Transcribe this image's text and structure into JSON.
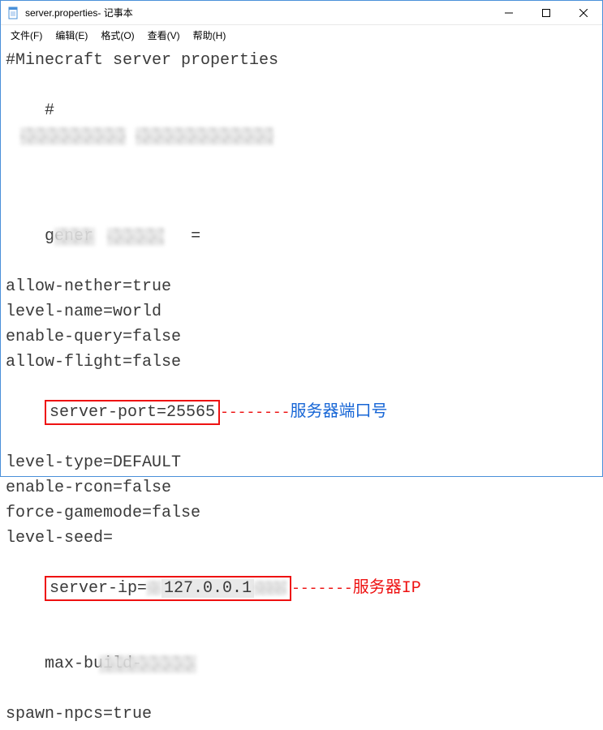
{
  "window": {
    "title": "server.properties- 记事本"
  },
  "menu": {
    "file": "文件(F)",
    "edit": "编辑(E)",
    "format": "格式(O)",
    "view": "查看(V)",
    "help": "帮助(H)"
  },
  "content": {
    "l0": "#Minecraft server properties",
    "l1a": "#",
    "l2a": "gener",
    "l2b": "=",
    "l3": "allow-nether=true",
    "l4": "level-name=world",
    "l5": "enable-query=false",
    "l6": "allow-flight=false",
    "l7": "server-port=25565",
    "l8": "level-type=DEFAULT",
    "l9": "enable-rcon=false",
    "l10": "force-gamemode=false",
    "l11": "level-seed=",
    "l12a": "server-ip=",
    "l12b": "127.0.0.1",
    "l13a": "max-build-",
    "l14": "spawn-npcs=true"
  },
  "annotations": {
    "dashes": "--------",
    "port_label": "服务器端口号",
    "ip_dashes": "-------",
    "ip_label": "服务器IP"
  }
}
